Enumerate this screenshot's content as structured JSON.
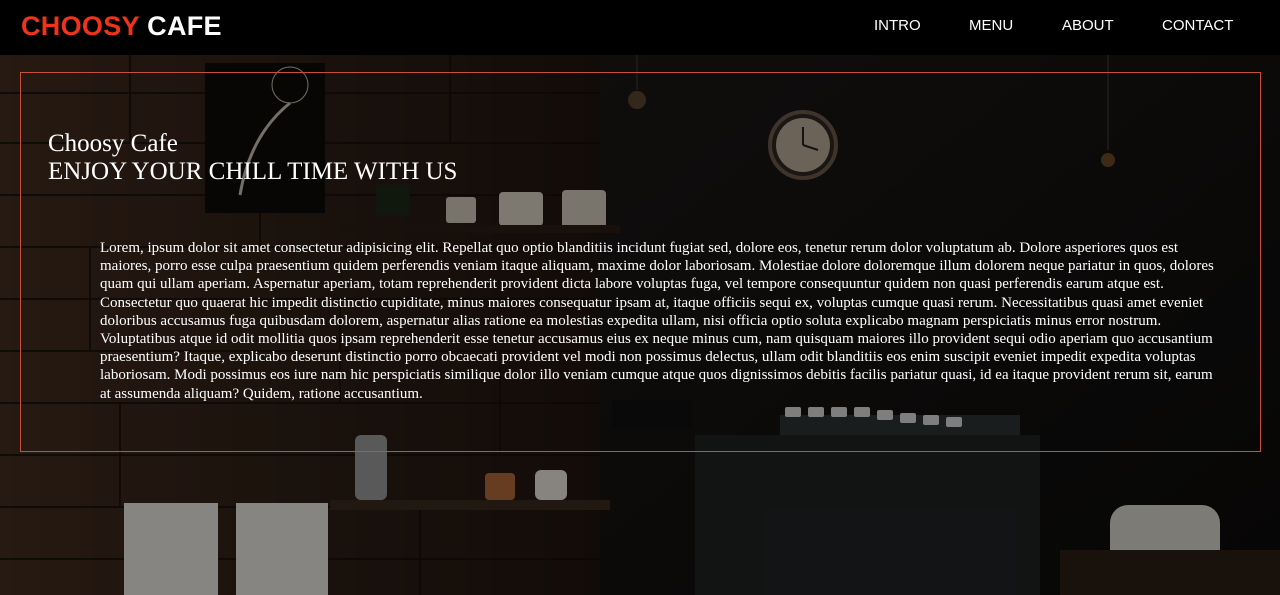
{
  "brand": {
    "word1": "CHOOSY",
    "word2": "CAFE",
    "accent_color": "#f0341c"
  },
  "nav": {
    "items": [
      {
        "label": "INTRO"
      },
      {
        "label": "MENU"
      },
      {
        "label": "ABOUT"
      },
      {
        "label": "CONTACT"
      }
    ]
  },
  "hero": {
    "title": "Choosy Cafe",
    "tagline": "ENJOY YOUR CHILL TIME WITH US",
    "body": "Lorem, ipsum dolor sit amet consectetur adipisicing elit. Repellat quo optio blanditiis incidunt fugiat sed, dolore eos, tenetur rerum dolor voluptatum ab. Dolore asperiores quos est maiores, porro esse culpa praesentium quidem perferendis veniam itaque aliquam, maxime dolor laboriosam. Molestiae dolore doloremque illum dolorem neque pariatur in quos, dolores quam qui ullam aperiam. Aspernatur aperiam, totam reprehenderit provident dicta labore voluptas fuga, vel tempore consequuntur quidem non quasi perferendis earum atque est. Consectetur quo quaerat hic impedit distinctio cupiditate, minus maiores consequatur ipsam at, itaque officiis sequi ex, voluptas cumque quasi rerum. Necessitatibus quasi amet eveniet doloribus accusamus fuga quibusdam dolorem, aspernatur alias ratione ea molestias expedita ullam, nisi officia optio soluta explicabo magnam perspiciatis minus error nostrum. Voluptatibus atque id odit mollitia quos ipsam reprehenderit esse tenetur accusamus eius ex neque minus cum, nam quisquam maiores illo provident sequi odio aperiam quo accusantium praesentium? Itaque, explicabo deserunt distinctio porro obcaecati provident vel modi non possimus delectus, ullam odit blanditiis eos enim suscipit eveniet impedit expedita voluptas laboriosam. Modi possimus eos iure nam hic perspiciatis similique dolor illo veniam cumque atque quos dignissimos debitis facilis pariatur quasi, id ea itaque provident rerum sit, earum at assumenda aliquam? Quidem, ratione accusantium."
  },
  "colors": {
    "frame_border": "#c8503a",
    "nav_bg": "#000000",
    "text": "#ffffff"
  }
}
